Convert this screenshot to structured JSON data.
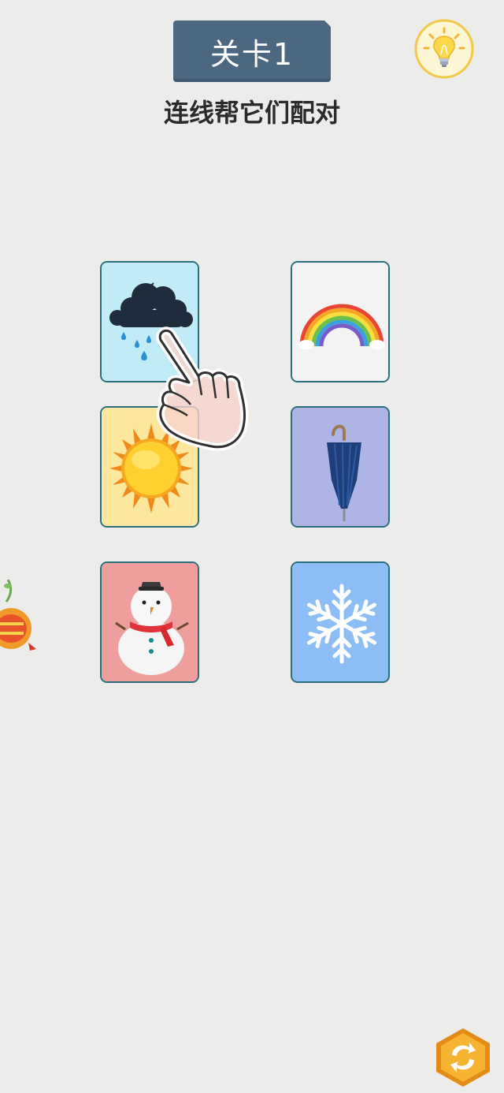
{
  "header": {
    "level_label": "关卡1",
    "instruction": "连线帮它们配对"
  },
  "buttons": {
    "hint_icon": "lightbulb-icon",
    "refresh_icon": "refresh-icon"
  },
  "cards": {
    "left": [
      {
        "picture": "rain-cloud-icon",
        "bg": "#c1ebf6"
      },
      {
        "picture": "sun-icon",
        "bg": "#fce79d"
      },
      {
        "picture": "snowman-icon",
        "bg": "#ef9e9e"
      }
    ],
    "right": [
      {
        "picture": "rainbow-icon",
        "bg": "#f3f3f3"
      },
      {
        "picture": "umbrella-icon",
        "bg": "#aeb5e6"
      },
      {
        "picture": "snowflake-icon",
        "bg": "#8dbdf5"
      }
    ]
  },
  "colors": {
    "background": "#ececea",
    "badge": "#4b6781",
    "card_border": "#2a6f7c"
  }
}
